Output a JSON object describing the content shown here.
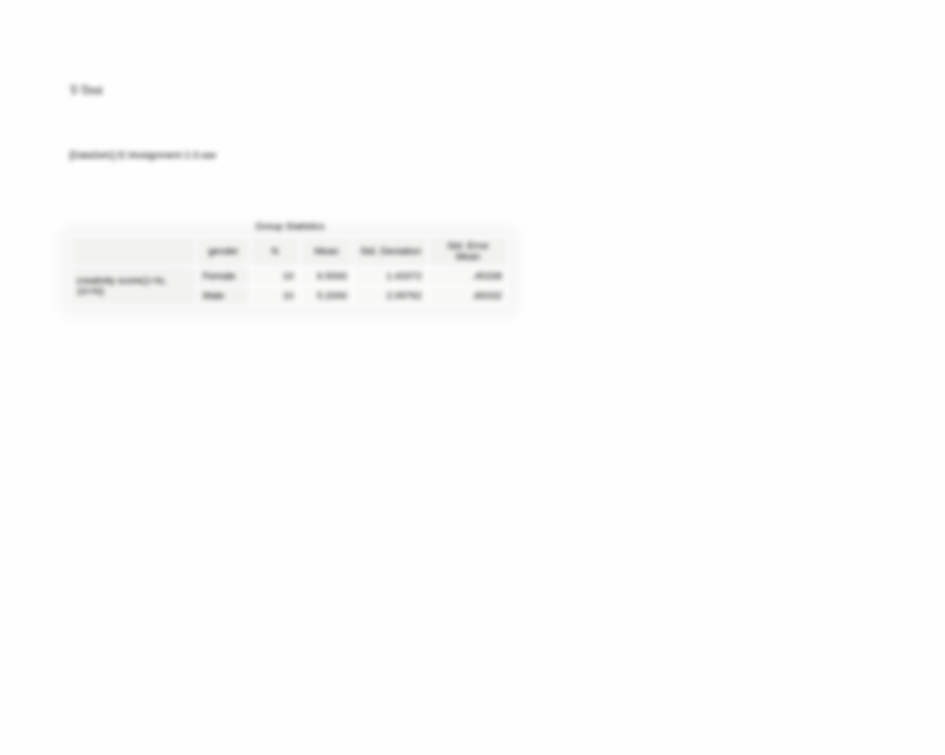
{
  "title": "T-Test",
  "dataset_line": "[DataSet1] E:\\Assignment 2-3.sav",
  "table": {
    "caption": "Group Statistics",
    "headers": {
      "var": "",
      "gender": "gender",
      "n": "N",
      "mean": "Mean",
      "std_dev": "Std. Deviation",
      "std_err": "Std. Error Mean"
    },
    "variable_label": "creativity score(1=lo, 10=hi)",
    "rows": [
      {
        "gender": "Female",
        "n": "10",
        "mean": "6.5000",
        "std_dev": "1.43372",
        "std_err": ".45338"
      },
      {
        "gender": "Male",
        "n": "10",
        "mean": "5.2000",
        "std_dev": "2.09762",
        "std_err": ".66332"
      }
    ]
  }
}
